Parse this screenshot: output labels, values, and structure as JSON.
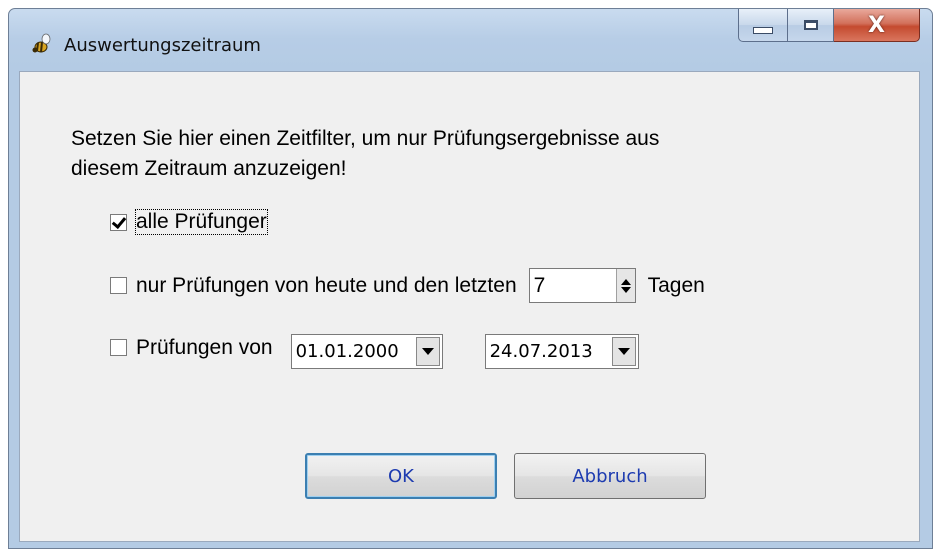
{
  "window": {
    "title": "Auswertungszeitraum",
    "icon": "bee-icon",
    "controls": {
      "minimize": "minimize-icon",
      "maximize": "maximize-icon",
      "close": "X"
    }
  },
  "instruction": {
    "line1": "Setzen Sie hier einen Zeitfilter, um nur Prüfungsergebnisse aus",
    "line2": "diesem Zeitraum anzuzeigen!"
  },
  "options": {
    "all": {
      "label": "alle Prüfunger",
      "checked": true
    },
    "recent": {
      "label": "nur Prüfungen von heute und den letzten",
      "days": "7",
      "suffix": "Tagen",
      "checked": false
    },
    "range": {
      "label": "Prüfungen von",
      "from": "01.01.2000",
      "to": "24.07.2013",
      "checked": false
    }
  },
  "buttons": {
    "ok": "OK",
    "cancel": "Abbruch"
  },
  "colors": {
    "button_text": "#1d3bb0",
    "title_bar": "#b4cbe4",
    "client_bg": "#f0f0f0"
  }
}
